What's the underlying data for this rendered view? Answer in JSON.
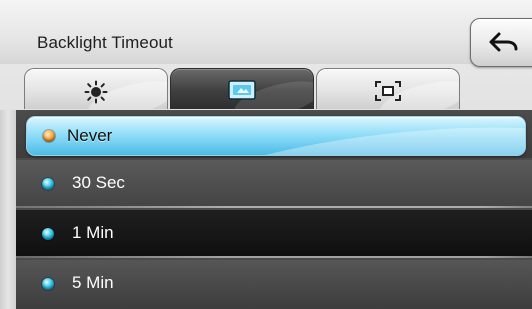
{
  "screen": {
    "title": "Backlight Timeout",
    "back_icon": "back-arrow-icon"
  },
  "tabs": [
    {
      "name": "brightness",
      "icon": "sun-icon",
      "active": false
    },
    {
      "name": "backlight",
      "icon": "screen-icon",
      "active": true
    },
    {
      "name": "screen-lock",
      "icon": "frame-icon",
      "active": false
    }
  ],
  "options": [
    {
      "label": "Never",
      "selected": true,
      "color": "#ffa63a"
    },
    {
      "label": "30 Sec",
      "selected": false,
      "color": "#34c4ee"
    },
    {
      "label": "1 Min",
      "selected": false,
      "color": "#34c4ee"
    },
    {
      "label": "5 Min",
      "selected": false,
      "color": "#34c4ee"
    }
  ],
  "colors": {
    "accent": "#4cbbe7",
    "list_bg": "#4b4b4b"
  }
}
